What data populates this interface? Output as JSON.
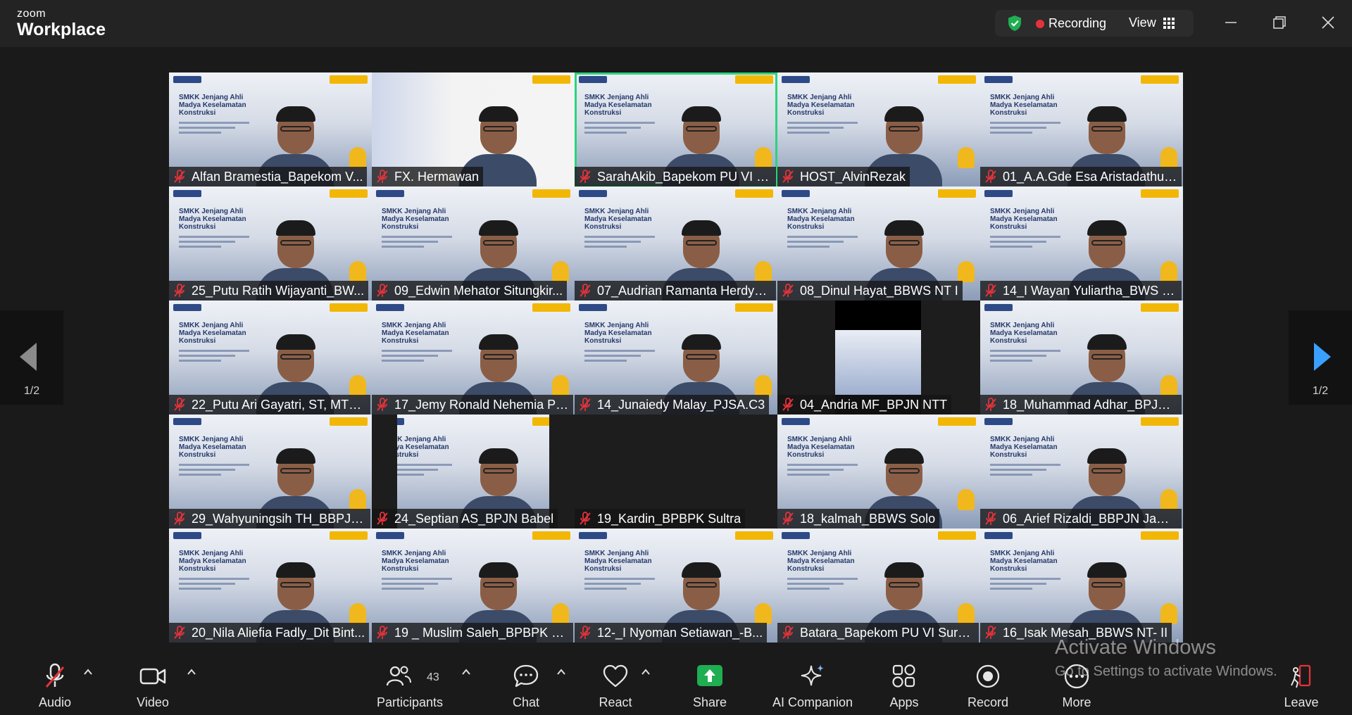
{
  "titlebar": {
    "brand_small": "zoom",
    "brand_big": "Workplace",
    "recording_label": "Recording",
    "view_label": "View",
    "recording_color": "#e5323a",
    "shield_color": "#1fae51"
  },
  "pager": {
    "left_label": "1/2",
    "right_label": "1/2"
  },
  "slide": {
    "title": "SMKK Jenjang Ahli Madya Keselamatan Konstruksi"
  },
  "participants": [
    {
      "name": "Alfan Bramestia_Bapekom V..."
    },
    {
      "name": "FX. Hermawan"
    },
    {
      "name": "SarahAkib_Bapekom PU VI Sura..."
    },
    {
      "name": "HOST_AlvinRezak"
    },
    {
      "name": "01_A.A.Gde Esa Aristadathu ..."
    },
    {
      "name": "25_Putu Ratih Wijayanti_BW..."
    },
    {
      "name": "09_Edwin Mehator Situngkir..."
    },
    {
      "name": "07_Audrian Ramanta Herdy_..."
    },
    {
      "name": "08_Dinul Hayat_BBWS NT I"
    },
    {
      "name": "14_I Wayan Yuliartha_BWS B..."
    },
    {
      "name": "22_Putu Ari Gayatri, ST, MT_..."
    },
    {
      "name": "17_Jemy Ronald Nehemia Pa..."
    },
    {
      "name": "14_Junaiedy Malay_PJSA.C3"
    },
    {
      "name": "04_Andria MF_BPJN NTT"
    },
    {
      "name": "18_Muhammad Adhar_BPJN..."
    },
    {
      "name": "29_Wahyuningsih TH_BBPJN..."
    },
    {
      "name": "24_Septian AS_BPJN Babel"
    },
    {
      "name": "19_Kardin_BPBPK Sultra"
    },
    {
      "name": "18_kalmah_BBWS Solo"
    },
    {
      "name": "06_Arief Rizaldi_BBPJN Jawa..."
    },
    {
      "name": "20_Nila Aliefia Fadly_Dit Bint..."
    },
    {
      "name": "19 _ Muslim Saleh_BPBPK N..."
    },
    {
      "name": "12-_I Nyoman Setiawan_-B..."
    },
    {
      "name": "Batara_Bapekom PU VI Sura..."
    },
    {
      "name": "16_Isak Mesah_BBWS NT- II"
    }
  ],
  "toolbar": {
    "audio": "Audio",
    "video": "Video",
    "participants": "Participants",
    "participants_count": "43",
    "chat": "Chat",
    "react": "React",
    "share": "Share",
    "ai_companion": "AI Companion",
    "apps": "Apps",
    "record": "Record",
    "more": "More",
    "leave": "Leave",
    "share_color": "#1fae51",
    "leave_color": "#e5323a"
  },
  "watermark": {
    "title": "Activate Windows",
    "subtitle": "Go to Settings to activate Windows."
  }
}
